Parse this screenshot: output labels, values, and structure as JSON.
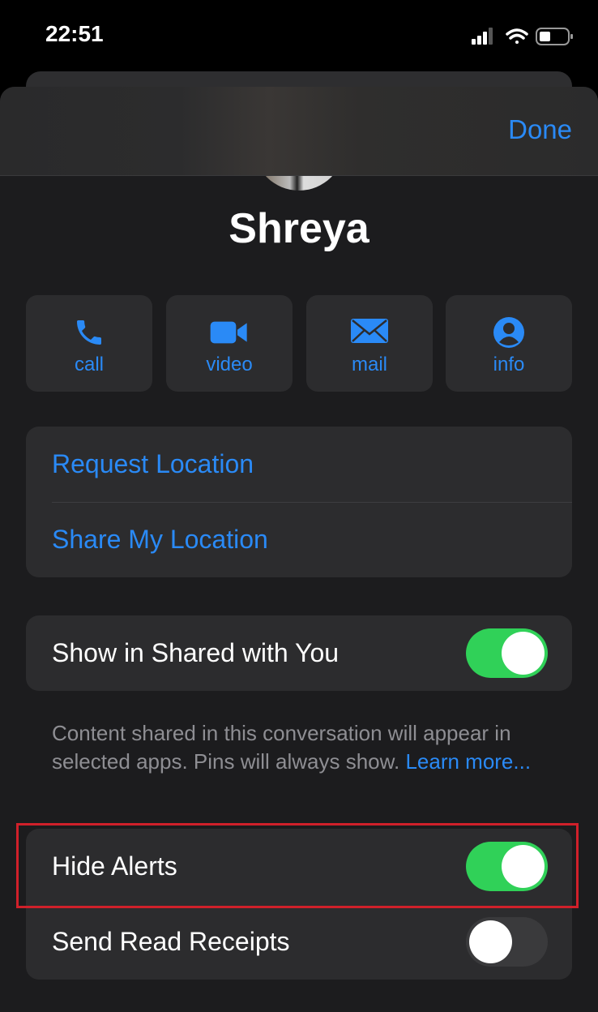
{
  "status_bar": {
    "time": "22:51",
    "icons": [
      "cellular-signal-icon",
      "wifi-icon",
      "battery-icon"
    ]
  },
  "header": {
    "done_label": "Done"
  },
  "contact": {
    "name": "Shreya"
  },
  "actions": [
    {
      "label": "call",
      "icon": "phone-icon"
    },
    {
      "label": "video",
      "icon": "video-camera-icon"
    },
    {
      "label": "mail",
      "icon": "envelope-icon"
    },
    {
      "label": "info",
      "icon": "person-circle-icon"
    }
  ],
  "location": {
    "request": "Request Location",
    "share": "Share My Location"
  },
  "shared": {
    "label": "Show in Shared with You",
    "enabled": true,
    "footnote": "Content shared in this conversation will appear in selected apps. Pins will always show.",
    "learn_more": "Learn more..."
  },
  "settings": [
    {
      "label": "Hide Alerts",
      "enabled": true
    },
    {
      "label": "Send Read Receipts",
      "enabled": false
    }
  ],
  "colors": {
    "accent": "#2a8af6",
    "toggle_on": "#30d158",
    "highlight": "#d0202a"
  }
}
